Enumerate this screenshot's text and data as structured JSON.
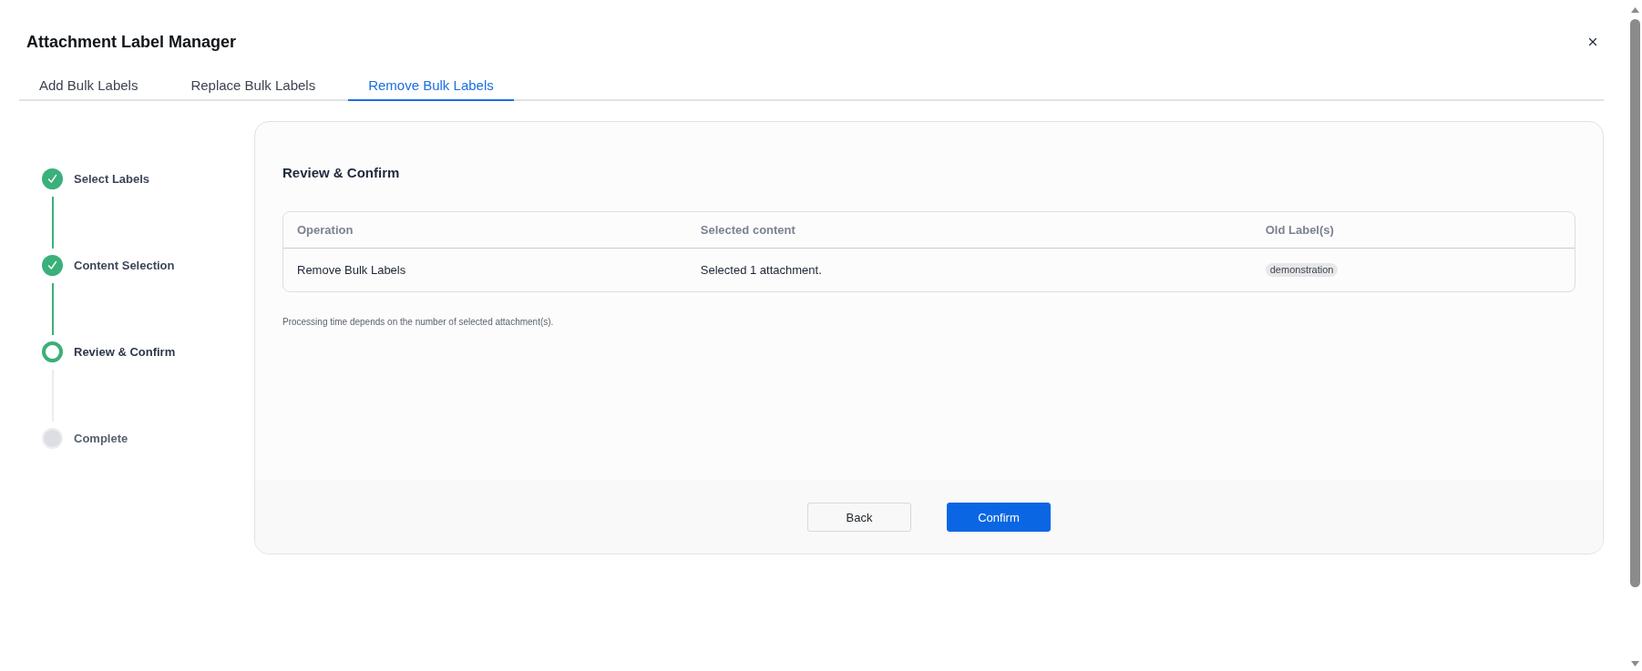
{
  "dialog": {
    "title": "Attachment Label Manager"
  },
  "tabs": [
    {
      "label": "Add Bulk Labels",
      "selected": false
    },
    {
      "label": "Replace Bulk Labels",
      "selected": false
    },
    {
      "label": "Remove Bulk Labels",
      "selected": true
    }
  ],
  "steps": [
    {
      "label": "Select Labels",
      "completed": true,
      "current": false
    },
    {
      "label": "Content Selection",
      "completed": true,
      "current": false
    },
    {
      "label": "Review & Confirm",
      "completed": false,
      "current": true
    },
    {
      "label": "Complete",
      "completed": false,
      "current": false
    }
  ],
  "review": {
    "heading": "Review & Confirm",
    "table": {
      "columns": [
        "Operation",
        "Selected content",
        "Old Label(s)"
      ],
      "rows": [
        {
          "cells": [
            {
              "kind": "text",
              "text": "Remove Bulk Labels"
            },
            {
              "kind": "text",
              "text": "Selected 1 attachment."
            },
            {
              "kind": "tags",
              "tags": [
                "demonstration"
              ]
            }
          ]
        }
      ]
    },
    "note": "Processing time depends on the number of selected attachment(s)."
  },
  "buttons": [
    {
      "label": "Back",
      "kind": "secondary"
    },
    {
      "label": "Confirm",
      "kind": "primary"
    }
  ]
}
